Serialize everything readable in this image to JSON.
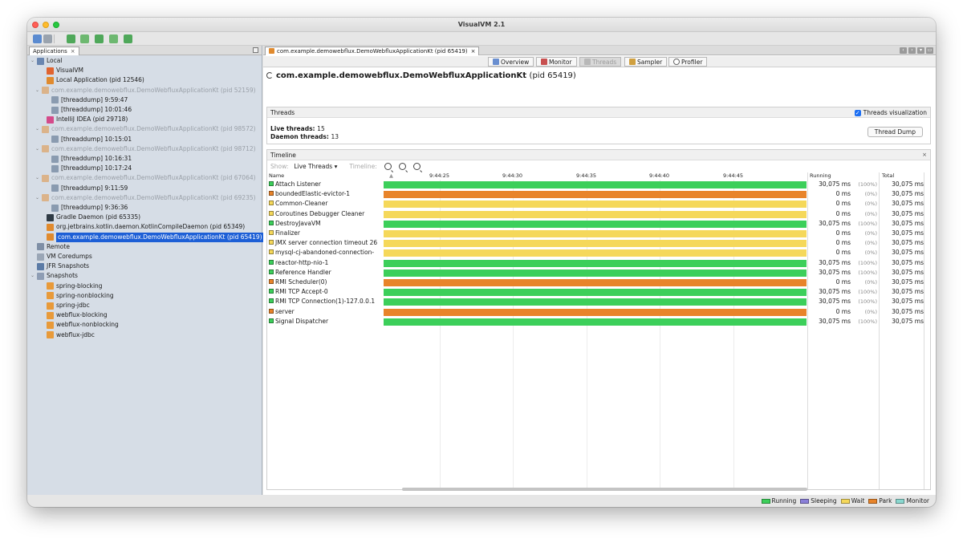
{
  "window": {
    "title": "VisualVM 2.1"
  },
  "colors": {
    "running": "#3ccf5a",
    "sleeping": "#8a7fd8",
    "wait": "#f5d85a",
    "park": "#e8842a",
    "monitor": "#8ad8d0",
    "selection": "#1d5fd6"
  },
  "applications_tab": {
    "label": "Applications",
    "close": "×"
  },
  "tree": [
    {
      "label": "Local",
      "icon": "computer-icon",
      "indent": 0,
      "arrow": "⌄",
      "dim": false
    },
    {
      "label": "VisualVM",
      "icon": "visualvm-icon",
      "indent": 2,
      "dim": false
    },
    {
      "label": "Local Application (pid 12546)",
      "icon": "java-icon",
      "indent": 2,
      "dim": false
    },
    {
      "label": "com.example.demowebflux.DemoWebfluxApplicationKt (pid 52159)",
      "icon": "java-icon",
      "indent": 1,
      "arrow": "⌄",
      "dim": true
    },
    {
      "label": "[threaddump] 9:59:47",
      "icon": "threaddump-icon",
      "indent": 3,
      "dim": false
    },
    {
      "label": "[threaddump] 10:01:46",
      "icon": "threaddump-icon",
      "indent": 3,
      "dim": false
    },
    {
      "label": "IntelliJ IDEA (pid 29718)",
      "icon": "intellij-icon",
      "indent": 2,
      "dim": false
    },
    {
      "label": "com.example.demowebflux.DemoWebfluxApplicationKt (pid 98572)",
      "icon": "java-icon",
      "indent": 1,
      "arrow": "⌄",
      "dim": true
    },
    {
      "label": "[threaddump] 10:15:01",
      "icon": "threaddump-icon",
      "indent": 3,
      "dim": false
    },
    {
      "label": "com.example.demowebflux.DemoWebfluxApplicationKt (pid 98712)",
      "icon": "java-icon",
      "indent": 1,
      "arrow": "⌄",
      "dim": true
    },
    {
      "label": "[threaddump] 10:16:31",
      "icon": "threaddump-icon",
      "indent": 3,
      "dim": false
    },
    {
      "label": "[threaddump] 10:17:24",
      "icon": "threaddump-icon",
      "indent": 3,
      "dim": false
    },
    {
      "label": "com.example.demowebflux.DemoWebfluxApplicationKt (pid 67064)",
      "icon": "java-icon",
      "indent": 1,
      "arrow": "⌄",
      "dim": true
    },
    {
      "label": "[threaddump] 9:11:59",
      "icon": "threaddump-icon",
      "indent": 3,
      "dim": false
    },
    {
      "label": "com.example.demowebflux.DemoWebfluxApplicationKt (pid 69235)",
      "icon": "java-icon",
      "indent": 1,
      "arrow": "⌄",
      "dim": true
    },
    {
      "label": "[threaddump] 9:36:36",
      "icon": "threaddump-icon",
      "indent": 3,
      "dim": false
    },
    {
      "label": "Gradle Daemon (pid 65335)",
      "icon": "gradle-icon",
      "indent": 2,
      "dim": false
    },
    {
      "label": "org.jetbrains.kotlin.daemon.KotlinCompileDaemon (pid 65349)",
      "icon": "java-icon",
      "indent": 2,
      "dim": false
    },
    {
      "label": "com.example.demowebflux.DemoWebfluxApplicationKt (pid 65419)",
      "icon": "java-icon",
      "indent": 2,
      "dim": false,
      "selected": true
    },
    {
      "label": "Remote",
      "icon": "remote-icon",
      "indent": 0,
      "dim": false
    },
    {
      "label": "VM Coredumps",
      "icon": "coredump-icon",
      "indent": 0,
      "dim": false
    },
    {
      "label": "JFR Snapshots",
      "icon": "jfr-icon",
      "indent": 0,
      "dim": false
    },
    {
      "label": "Snapshots",
      "icon": "snapshots-icon",
      "indent": 0,
      "arrow": "⌄",
      "dim": false
    },
    {
      "label": "spring-blocking",
      "icon": "snapshot-java-icon",
      "indent": 2,
      "dim": false
    },
    {
      "label": "spring-nonblocking",
      "icon": "snapshot-java-icon",
      "indent": 2,
      "dim": false
    },
    {
      "label": "spring-jdbc",
      "icon": "snapshot-java-icon",
      "indent": 2,
      "dim": false
    },
    {
      "label": "webflux-blocking",
      "icon": "snapshot-java-icon",
      "indent": 2,
      "dim": false
    },
    {
      "label": "webflux-nonblocking",
      "icon": "snapshot-java-icon",
      "indent": 2,
      "dim": false
    },
    {
      "label": "webflux-jdbc",
      "icon": "snapshot-java-icon",
      "indent": 2,
      "dim": false
    }
  ],
  "doc_tab": {
    "label": "com.example.demowebflux.DemoWebfluxApplicationKt (pid 65419)",
    "close": "×"
  },
  "view_tabs": [
    {
      "label": "Overview",
      "icon": "overview-icon",
      "active": false
    },
    {
      "label": "Monitor",
      "icon": "monitor-icon",
      "active": false
    },
    {
      "label": "Threads",
      "icon": "threads-icon",
      "active": true
    },
    {
      "label": "Sampler",
      "icon": "sampler-icon",
      "active": false
    },
    {
      "label": "Profiler",
      "icon": "profiler-icon",
      "active": false
    }
  ],
  "process": {
    "name": "com.example.demowebflux.DemoWebfluxApplicationKt",
    "pid": "(pid 65419)"
  },
  "threads_section": {
    "title": "Threads",
    "visualization_label": "Threads visualization",
    "live_label": "Live threads:",
    "live_value": "15",
    "daemon_label": "Daemon threads:",
    "daemon_value": "13",
    "dump_button": "Thread Dump"
  },
  "timeline": {
    "title": "Timeline",
    "close": "×",
    "show_label": "Show:",
    "show_value": "Live Threads",
    "timeline_label": "Timeline:",
    "col_name": "Name",
    "col_running": "Running",
    "col_total": "Total",
    "ticks": [
      "9:44:25",
      "9:44:30",
      "9:44:35",
      "9:44:40",
      "9:44:45"
    ]
  },
  "threads": [
    {
      "name": "Attach Listener",
      "state": "running",
      "running": "30,075 ms",
      "pct": "(100%)",
      "total": "30,075 ms"
    },
    {
      "name": "boundedElastic-evictor-1",
      "state": "park",
      "running": "0 ms",
      "pct": "(0%)",
      "total": "30,075 ms"
    },
    {
      "name": "Common-Cleaner",
      "state": "wait",
      "running": "0 ms",
      "pct": "(0%)",
      "total": "30,075 ms"
    },
    {
      "name": "Coroutines Debugger Cleaner",
      "state": "wait",
      "running": "0 ms",
      "pct": "(0%)",
      "total": "30,075 ms"
    },
    {
      "name": "DestroyJavaVM",
      "state": "running",
      "running": "30,075 ms",
      "pct": "(100%)",
      "total": "30,075 ms"
    },
    {
      "name": "Finalizer",
      "state": "wait",
      "running": "0 ms",
      "pct": "(0%)",
      "total": "30,075 ms"
    },
    {
      "name": "JMX server connection timeout 26",
      "state": "wait",
      "running": "0 ms",
      "pct": "(0%)",
      "total": "30,075 ms"
    },
    {
      "name": "mysql-cj-abandoned-connection-",
      "state": "wait",
      "running": "0 ms",
      "pct": "(0%)",
      "total": "30,075 ms"
    },
    {
      "name": "reactor-http-nio-1",
      "state": "running",
      "running": "30,075 ms",
      "pct": "(100%)",
      "total": "30,075 ms"
    },
    {
      "name": "Reference Handler",
      "state": "running",
      "running": "30,075 ms",
      "pct": "(100%)",
      "total": "30,075 ms"
    },
    {
      "name": "RMI Scheduler(0)",
      "state": "park",
      "running": "0 ms",
      "pct": "(0%)",
      "total": "30,075 ms"
    },
    {
      "name": "RMI TCP Accept-0",
      "state": "running",
      "running": "30,075 ms",
      "pct": "(100%)",
      "total": "30,075 ms"
    },
    {
      "name": "RMI TCP Connection(1)-127.0.0.1",
      "state": "running",
      "running": "30,075 ms",
      "pct": "(100%)",
      "total": "30,075 ms"
    },
    {
      "name": "server",
      "state": "park",
      "running": "0 ms",
      "pct": "(0%)",
      "total": "30,075 ms"
    },
    {
      "name": "Signal Dispatcher",
      "state": "running",
      "running": "30,075 ms",
      "pct": "(100%)",
      "total": "30,075 ms"
    }
  ],
  "legend": [
    {
      "label": "Running",
      "state": "running"
    },
    {
      "label": "Sleeping",
      "state": "sleeping"
    },
    {
      "label": "Wait",
      "state": "wait"
    },
    {
      "label": "Park",
      "state": "park"
    },
    {
      "label": "Monitor",
      "state": "monitor"
    }
  ]
}
